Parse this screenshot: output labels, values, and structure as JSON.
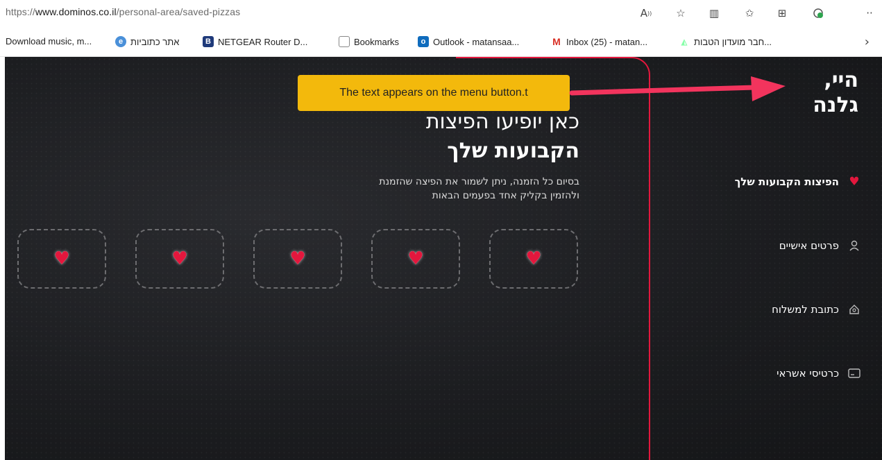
{
  "browser": {
    "url_prefix": "https://",
    "url_domain": "www.dominos.co.il",
    "url_path": "/personal-area/saved-pizzas",
    "icons": [
      "read-aloud-icon",
      "favorite-star-icon",
      "split-screen-icon",
      "favorites-icon",
      "collections-icon",
      "extension-icon",
      "more-icon"
    ]
  },
  "bookmarks": [
    {
      "label": "Download music, m...",
      "icon": ""
    },
    {
      "label": "אתר כתוביות",
      "icon": "globe"
    },
    {
      "label": "NETGEAR Router D...",
      "icon": "netgear"
    },
    {
      "label": "Bookmarks",
      "icon": "page"
    },
    {
      "label": "Outlook - matansaa...",
      "icon": "outlook"
    },
    {
      "label": "Inbox (25) - matan...",
      "icon": "gmail"
    },
    {
      "label": "חבר מועדון הטבות...",
      "icon": "club"
    }
  ],
  "greeting": {
    "line1": "היי,",
    "line2": "גלנה"
  },
  "menu": [
    {
      "label": "הפיצות הקבועות שלך",
      "icon": "♥",
      "active": true
    },
    {
      "label": "פרטים אישיים",
      "icon": "person"
    },
    {
      "label": "כתובת למשלוח",
      "icon": "home"
    },
    {
      "label": "כרטיסי אשראי",
      "icon": "card"
    }
  ],
  "main": {
    "title_line1": "כאן יופיעו הפיצות",
    "title_line2": "הקבועות שלך",
    "subtitle_line1": "בסיום כל הזמנה, ניתן לשמור את הפיצה שהזמנת",
    "subtitle_line2": "ולהזמין בקליק אחד בפעמים הבאות"
  },
  "annotation": {
    "text": "The text appears on the menu button.t"
  },
  "colors": {
    "accent": "#e3173d",
    "annotation": "#f3b90c"
  }
}
